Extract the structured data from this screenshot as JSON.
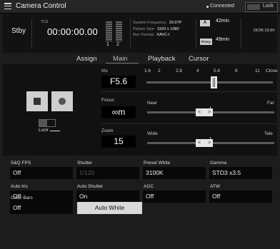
{
  "titlebar": {
    "title": "Camera Control",
    "connection": "Connected",
    "lock_label": "Lock"
  },
  "status": {
    "state": "Stby",
    "tc_label": "TCG",
    "timecode": "00:00:00.00",
    "meter_channels": [
      "1",
      "2"
    ],
    "system_frequency_label": "System Frequency",
    "system_frequency": "29.97P",
    "picture_size_label": "Picture Size",
    "picture_size": "1920 x 1080",
    "rec_format_label": "Rec Format",
    "rec_format": "XAVC-I",
    "battery_a_label": "A",
    "battery_a_time": "42min",
    "battery_proxy_label": "Proxy",
    "battery_proxy_time": "49min",
    "dcin": "DCIN 19.9V"
  },
  "tabs": [
    {
      "label": "Assign"
    },
    {
      "label": "Main",
      "active": true
    },
    {
      "label": "Playback"
    },
    {
      "label": "Cursor"
    }
  ],
  "recording": {
    "lock_label": "Lock"
  },
  "iris": {
    "label": "Iris",
    "value": "F5.6",
    "scale": [
      "1.6",
      "2",
      "2.8",
      "4",
      "5.6",
      "8",
      "11",
      "Close"
    ],
    "position_fraction": 0.535
  },
  "focus": {
    "label": "Focus",
    "value": "∞m",
    "near_label": "Near",
    "far_label": "Far",
    "position_fraction": 0.45
  },
  "zoom": {
    "label": "Zoom",
    "value": "15",
    "wide_label": "Wide",
    "tele_label": "Tele",
    "position_fraction": 0.45
  },
  "settings": {
    "sq_fps": {
      "label": "S&Q FPS",
      "value": "Off"
    },
    "shutter": {
      "label": "Shutter",
      "value": "1/120"
    },
    "preset_white": {
      "label": "Preset White",
      "value": "3100K"
    },
    "gamma": {
      "label": "Gamma",
      "value": "STD3 x3.5"
    },
    "auto_iris": {
      "label": "Auto Iris",
      "value": "Off"
    },
    "auto_shutter": {
      "label": "Auto Shutter",
      "value": "On"
    },
    "agc": {
      "label": "AGC",
      "value": "Off"
    },
    "atw": {
      "label": "ATW",
      "value": "Off"
    },
    "color_bars": {
      "label": "Color Bars",
      "value": "Off"
    },
    "auto_white_label": "Auto White"
  },
  "colors": {
    "background": "#1c1c1c",
    "panel": "#111111",
    "knob": "#e6e6e6",
    "text": "#e8e8e8"
  }
}
